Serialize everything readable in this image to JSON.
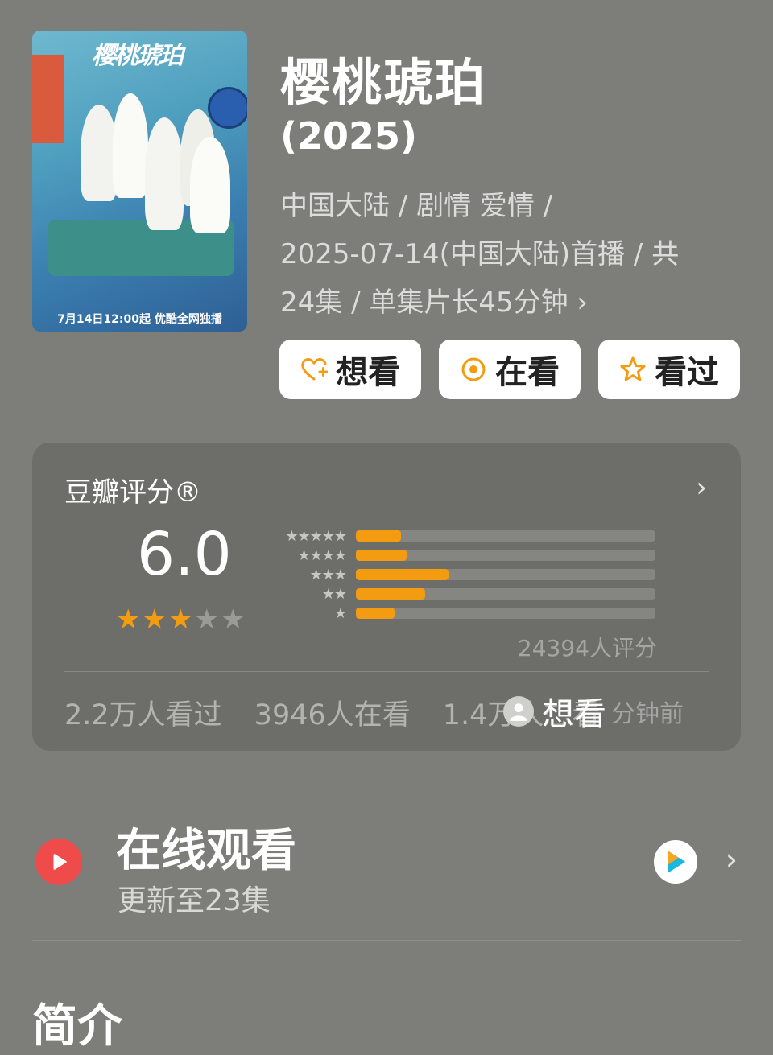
{
  "poster": {
    "logo_text": "樱桃琥珀",
    "release_text": "7月14日12:00起 优酷全网独播"
  },
  "header": {
    "title": "樱桃琥珀",
    "year": "(2025)",
    "meta_line1": "中国大陆 / 剧情 爱情 /",
    "meta_line2": "2025-07-14(中国大陆)首播 / 共",
    "meta_line3": "24集 / 单集片长45分钟",
    "meta_chevron": "›"
  },
  "actions": {
    "want": "想看",
    "watching": "在看",
    "watched": "看过"
  },
  "rating": {
    "label": "豆瓣评分®",
    "score": "6.0",
    "star_value": 3,
    "star_max": 5,
    "distribution": [
      {
        "stars": "★★★★★",
        "fraction": 0.15
      },
      {
        "stars": "★★★★",
        "fraction": 0.17
      },
      {
        "stars": "★★★",
        "fraction": 0.31
      },
      {
        "stars": "★★",
        "fraction": 0.23
      },
      {
        "stars": "★",
        "fraction": 0.13
      }
    ],
    "count_text": "24394人评分",
    "stats": {
      "watched": "2.2万人看过",
      "watching": "3946人在看",
      "want": "1.4万人想看"
    },
    "toast": {
      "action": "想看",
      "time": "分钟前"
    },
    "chevron": "›"
  },
  "online": {
    "title": "在线观看",
    "subtitle": "更新至23集",
    "chevron": "›"
  },
  "intro": {
    "heading": "简介"
  },
  "colors": {
    "accent": "#f39c12",
    "play": "#ef4b4b",
    "background": "#7d7d79",
    "card": "#6d6d6a"
  },
  "icons": [
    "heart-plus-icon",
    "target-icon",
    "star-outline-icon",
    "play-icon",
    "youku-icon",
    "avatar-icon",
    "chevron-right-icon"
  ]
}
